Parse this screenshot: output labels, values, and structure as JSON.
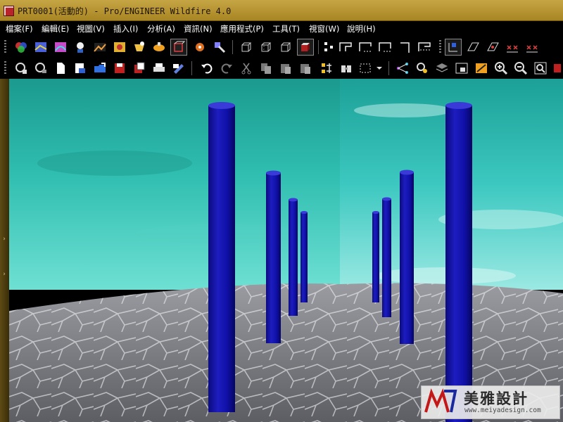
{
  "window": {
    "title": "PRT0001(活動的) - Pro/ENGINEER Wildfire 4.0"
  },
  "menu": [
    {
      "label": "檔案(F)"
    },
    {
      "label": "編輯(E)"
    },
    {
      "label": "視圖(V)"
    },
    {
      "label": "插入(I)"
    },
    {
      "label": "分析(A)"
    },
    {
      "label": "資訊(N)"
    },
    {
      "label": "應用程式(P)"
    },
    {
      "label": "工具(T)"
    },
    {
      "label": "視窗(W)"
    },
    {
      "label": "說明(H)"
    }
  ],
  "toolbar_top": {
    "icons": [
      "appearance-gallery-icon",
      "model-display-icon",
      "surface-analysis-icon",
      "light-icon",
      "scene-icon",
      "render-room-icon",
      "render-icon",
      "region-render-icon",
      "shading-toggle-icon",
      "spot-light-icon",
      "color-editor-icon",
      "wireframe-icon",
      "hidden-line-icon",
      "no-hidden-icon",
      "shading-icon",
      "datum-planes-icon",
      "datum-axes-icon",
      "datum-points-icon",
      "coord-systems-icon",
      "annotation-icon",
      "spin-center-icon",
      "orient-icon",
      "previous-view-icon",
      "refit-icon",
      "show-all-icon"
    ]
  },
  "toolbar_bottom": {
    "icons": [
      "model-tree-icon",
      "layer-icon",
      "new-file-icon",
      "open-file-icon",
      "working-dir-icon",
      "save-icon",
      "save-copy-icon",
      "print-icon",
      "send-mail-icon",
      "undo-icon",
      "redo-icon",
      "cut-icon",
      "copy-icon",
      "paste-icon",
      "paste-special-icon",
      "regenerate-icon",
      "find-icon",
      "select-box-icon",
      "relations-icon",
      "parameters-icon",
      "layers-panel-icon",
      "snapshot-icon",
      "repaint-icon",
      "zoom-in-icon",
      "zoom-out-icon",
      "refit-view-icon",
      "save-views-icon"
    ]
  },
  "viewport": {
    "sky_colors": [
      "#1fa59a",
      "#3ec9b5",
      "#7fe3d7"
    ],
    "pillar_color": "#1010a8",
    "floor_color": "#7d7d82"
  },
  "watermark": {
    "name": "美雅設計",
    "url": "www.meiyadesign.com"
  }
}
